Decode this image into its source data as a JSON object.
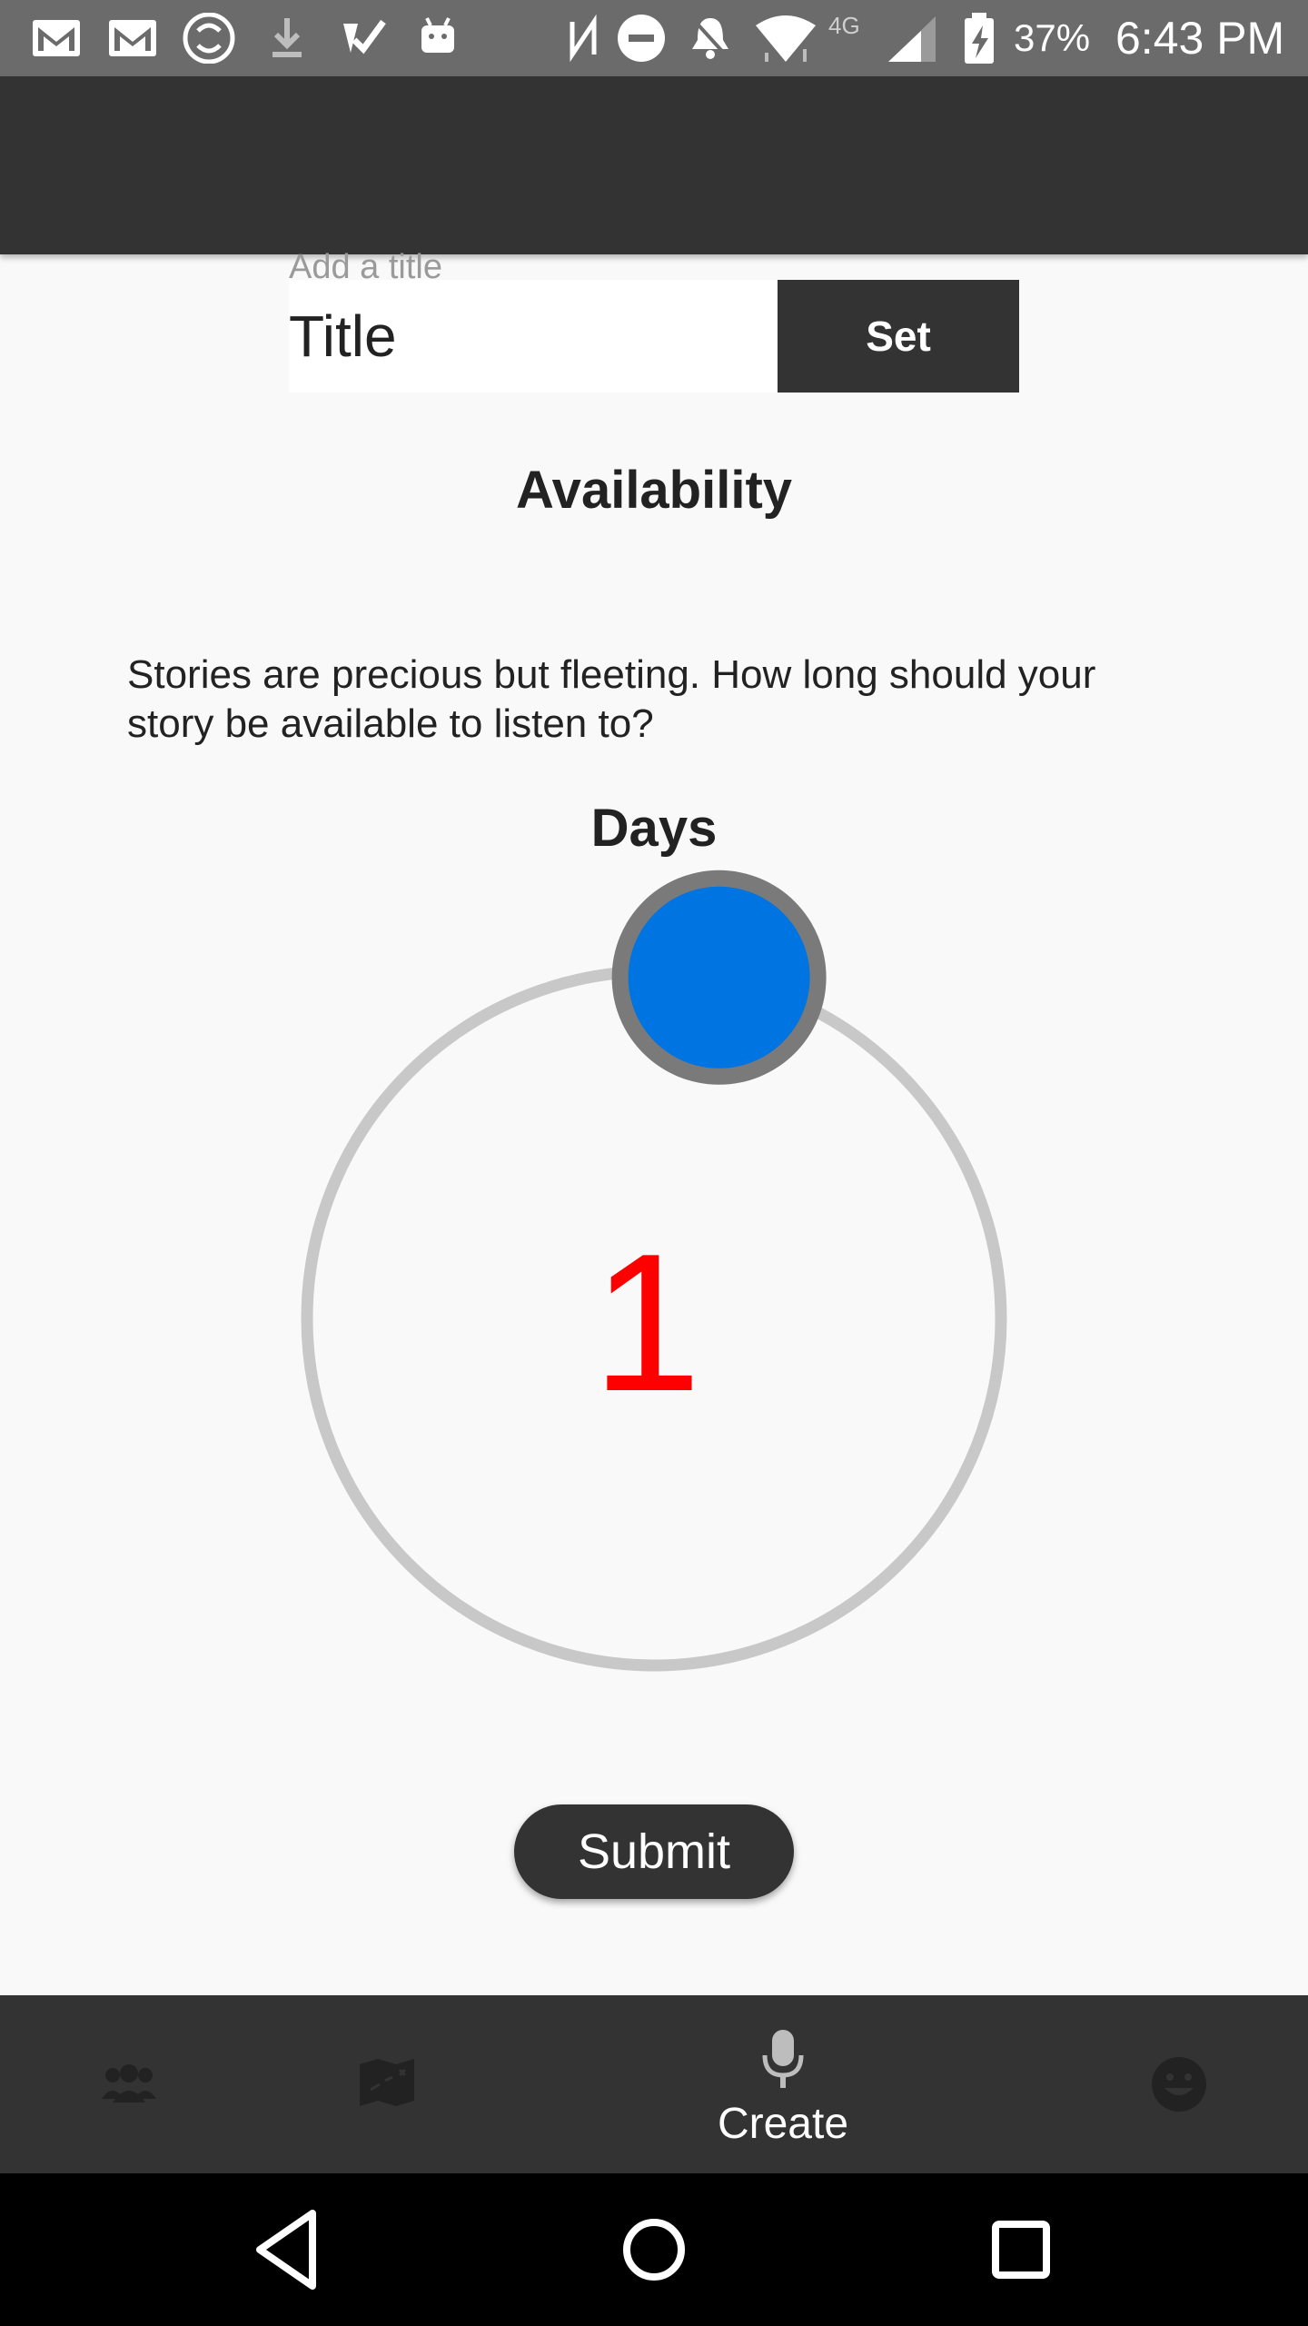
{
  "status_bar": {
    "battery_percent": "37%",
    "time": "6:43 PM",
    "network": "4G",
    "icons": [
      "gmail-icon",
      "gmail-icon",
      "sync-icon",
      "download-icon",
      "tasks-icon",
      "android-icon",
      "nfc-icon",
      "dnd-icon",
      "notifications-off-icon",
      "wifi-icon",
      "signal-icon",
      "battery-charging-icon"
    ]
  },
  "title_field": {
    "hint": "Add a title",
    "value": "Title",
    "set_label": "Set"
  },
  "availability": {
    "heading": "Availability",
    "description": "Stories are precious but fleeting. How long should your story be available to listen to?",
    "unit_label": "Days",
    "value": "1",
    "dial_position_fraction": 0.03
  },
  "submit_label": "Submit",
  "bottom_nav": {
    "items": [
      {
        "icon": "group-icon",
        "label": ""
      },
      {
        "icon": "map-icon",
        "label": ""
      },
      {
        "icon": "microphone-icon",
        "label": "Create"
      },
      {
        "icon": "smiley-icon",
        "label": ""
      }
    ],
    "active_index": 2
  },
  "colors": {
    "app_bar": "#333333",
    "dial_handle": "#0074e0",
    "dial_value": "#ff0000",
    "dial_track": "#c8c8c8"
  }
}
